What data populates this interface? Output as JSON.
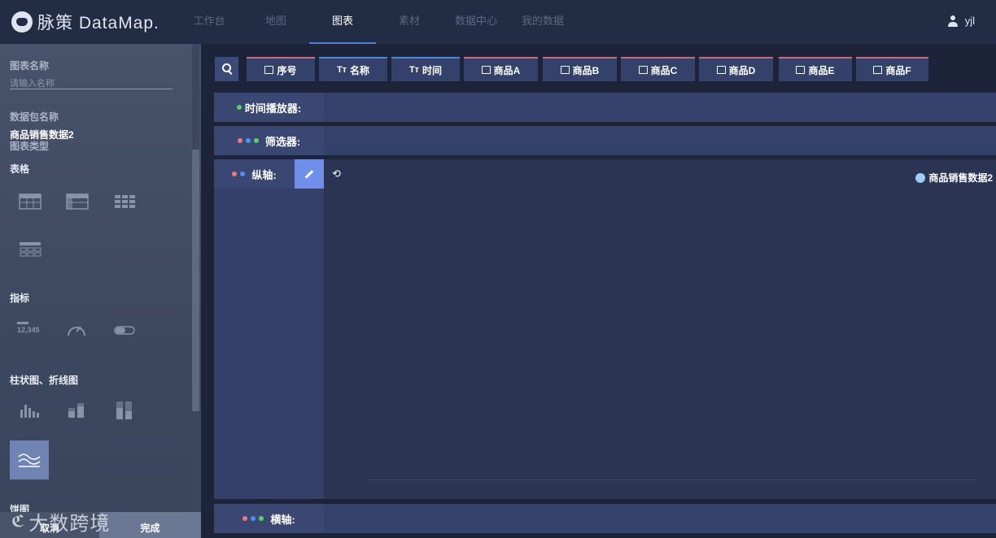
{
  "app": {
    "logo_text": "脉策 DataMap."
  },
  "nav": {
    "items": [
      "工作台",
      "地图",
      "图表",
      "素材",
      "数据中心",
      "我的数据"
    ],
    "active": "图表"
  },
  "user": {
    "name": "yjl"
  },
  "sidebar": {
    "chart_name_label": "图表名称",
    "chart_name_placeholder": "请输入名称",
    "package_label": "数据包名称",
    "package_value": "商品销售数据2",
    "chart_type_label": "图表类型",
    "section_table": "表格",
    "section_indicator": "指标",
    "indicator_sample": "12,345",
    "section_bar_line": "柱状图、折线图",
    "section_pie": "饼图",
    "cancel": "取消",
    "done": "完成",
    "watermark": "大数跨境"
  },
  "fields": [
    {
      "type": "num",
      "icon": "[1]",
      "label": "序号"
    },
    {
      "type": "txt",
      "icon": "Tт",
      "label": "名称"
    },
    {
      "type": "txt",
      "icon": "Tт",
      "label": "时间"
    },
    {
      "type": "num",
      "icon": "[1]",
      "label": "商品A"
    },
    {
      "type": "num",
      "icon": "[1]",
      "label": "商品B"
    },
    {
      "type": "num",
      "icon": "[1]",
      "label": "商品C"
    },
    {
      "type": "num",
      "icon": "[1]",
      "label": "商品D"
    },
    {
      "type": "num",
      "icon": "[1]",
      "label": "商品E"
    },
    {
      "type": "num",
      "icon": "[1]",
      "label": "商品F"
    }
  ],
  "rows": {
    "time_player": "时间播放器:",
    "filter": "筛选器:",
    "vaxis": "纵轴:",
    "haxis": "横轴:"
  },
  "legend": {
    "label": "商品销售数据2",
    "color": "#9fcdf7"
  }
}
